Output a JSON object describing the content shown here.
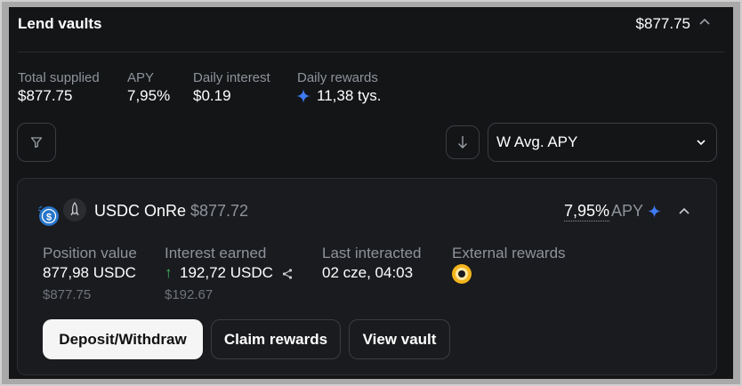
{
  "header": {
    "title": "Lend vaults",
    "total": "$877.75",
    "icon_chevron": "chevron-up-icon"
  },
  "stats": [
    {
      "label": "Total supplied",
      "value": "$877.75"
    },
    {
      "label": "APY",
      "value": "7,95%"
    },
    {
      "label": "Daily interest",
      "value": "$0.19"
    },
    {
      "label": "Daily rewards",
      "value": "11,38 tys.",
      "icon": "sparkle-icon"
    }
  ],
  "toolbar": {
    "filter_icon": "filter-icon",
    "sort_icon": "arrow-down-icon",
    "sort_select": "W Avg. APY"
  },
  "vault": {
    "name": "USDC OnRe",
    "usd_value": "$877.72",
    "apy": "7,95%",
    "apy_label": "APY",
    "position_label": "Position value",
    "position_value": "877,98 USDC",
    "position_usd": "$877.75",
    "interest_label": "Interest earned",
    "interest_arrow": "↑",
    "interest_value": "192,72 USDC",
    "interest_usd": "$192.67",
    "last_label": "Last interacted",
    "last_value": "02 cze, 04:03",
    "rewards_label": "External rewards",
    "buttons": {
      "deposit": "Deposit/Withdraw",
      "claim": "Claim rewards",
      "view": "View vault"
    }
  },
  "colors": {
    "background": "#141517",
    "card": "#1a1b1e",
    "accent": "#3e7bf5",
    "positive": "#3fbf6a",
    "reward_token": "#f2b51c"
  }
}
